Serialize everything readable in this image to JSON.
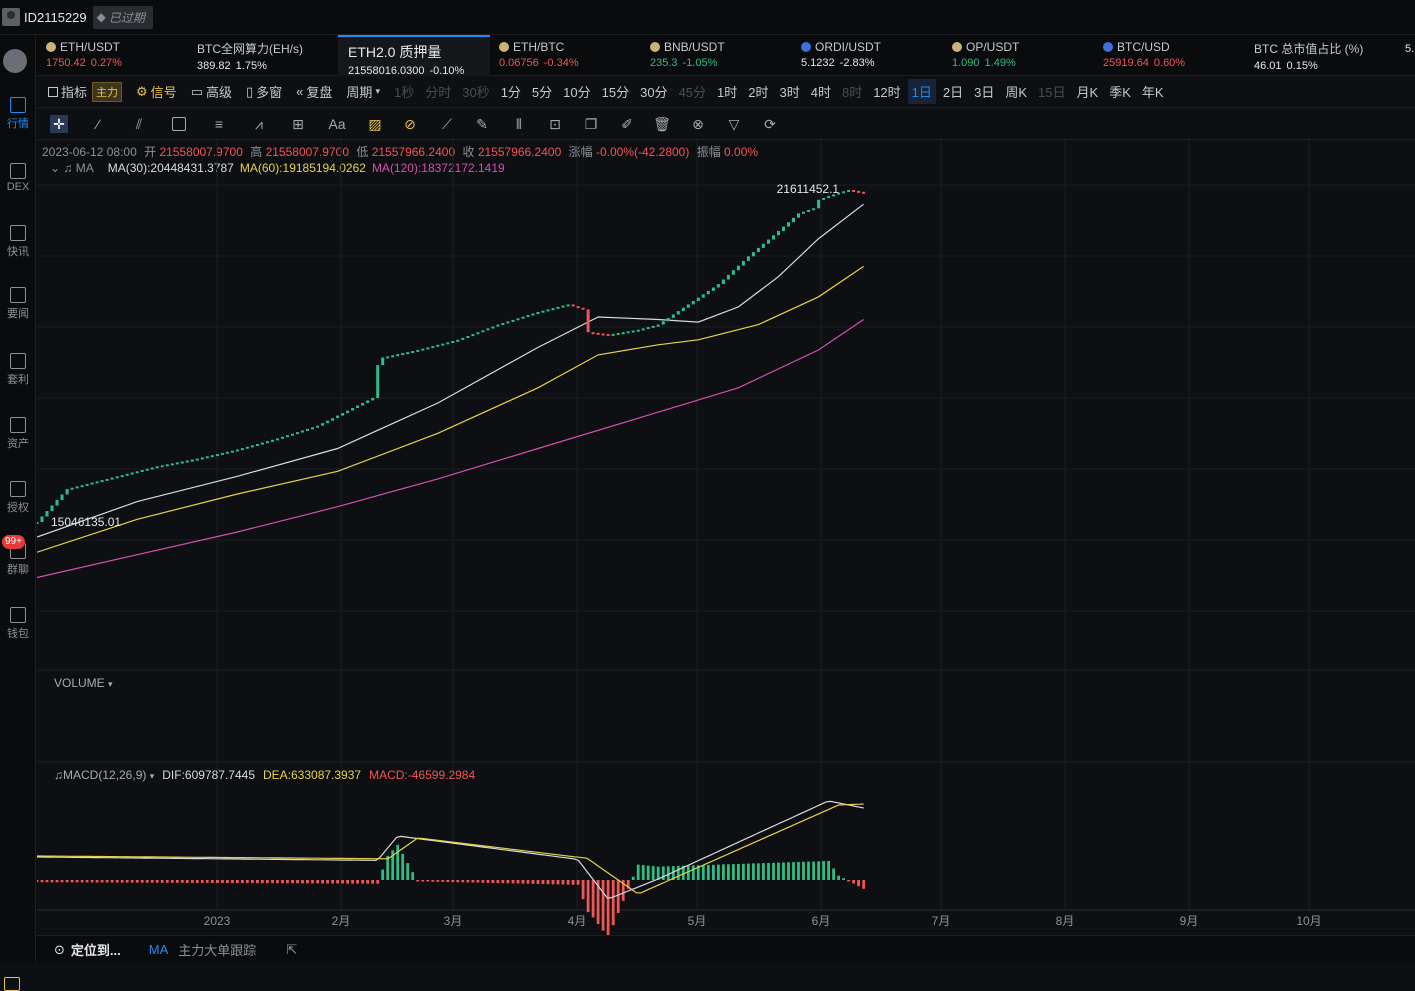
{
  "user": {
    "id": "ID2115229",
    "status": "已过期"
  },
  "sidebar": [
    {
      "label": "行情",
      "icon": "market-icon",
      "active": true
    },
    {
      "label": "DEX",
      "icon": "dex-icon"
    },
    {
      "label": "快讯",
      "icon": "flash-news-icon"
    },
    {
      "label": "要闻",
      "icon": "news-icon"
    },
    {
      "label": "套利",
      "icon": "arbitrage-icon"
    },
    {
      "label": "资产",
      "icon": "assets-icon"
    },
    {
      "label": "授权",
      "icon": "authorization-icon"
    },
    {
      "label": "群聊",
      "icon": "group-chat-icon",
      "badge": "99+"
    },
    {
      "label": "钱包",
      "icon": "wallet-icon"
    }
  ],
  "tickers": [
    {
      "name": "ETH/USDT",
      "price": "1750.42",
      "change": "0.27%",
      "dir": "dn",
      "dot": "gold"
    },
    {
      "name": "BTC全网算力(EH/s)",
      "price": "389.82",
      "change": "1.75%",
      "dir": "wt",
      "dot": ""
    },
    {
      "name": "ETH2.0 质押量",
      "price": "21558016.0300",
      "change": "-0.10%",
      "dir": "wt",
      "dot": "",
      "active": true
    },
    {
      "name": "ETH/BTC",
      "price": "0.06756",
      "change": "-0.34%",
      "dir": "dn",
      "dot": "gold"
    },
    {
      "name": "BNB/USDT",
      "price": "235.3",
      "change": "-1.05%",
      "dir": "up",
      "dot": "gold"
    },
    {
      "name": "ORDI/USDT",
      "price": "5.1232",
      "change": "-2.83%",
      "dir": "wt",
      "dot": "blue"
    },
    {
      "name": "OP/USDT",
      "price": "1.090",
      "change": "1.49%",
      "dir": "up",
      "dot": "gold"
    },
    {
      "name": "BTC/USD",
      "price": "25919.64",
      "change": "0.60%",
      "dir": "dn",
      "dot": "blue"
    },
    {
      "name": "BTC 总市值占比 (%)",
      "price": "46.01",
      "change": "0.15%",
      "dir": "wt",
      "dot": ""
    },
    {
      "name": "",
      "price": "5.",
      "change": "",
      "dir": "wt",
      "dot": ""
    }
  ],
  "periodbar": {
    "indicator": "指标",
    "main_tag": "主力",
    "signal": "信号",
    "advanced": "高级",
    "multi_window": "多窗",
    "replay": "复盘",
    "period": "周期",
    "periods": [
      {
        "label": "1秒",
        "dis": true
      },
      {
        "label": "分时",
        "dis": true
      },
      {
        "label": "30秒",
        "dis": true
      },
      {
        "label": "1分"
      },
      {
        "label": "5分"
      },
      {
        "label": "10分"
      },
      {
        "label": "15分"
      },
      {
        "label": "30分"
      },
      {
        "label": "45分",
        "dis": true
      },
      {
        "label": "1时"
      },
      {
        "label": "2时"
      },
      {
        "label": "3时"
      },
      {
        "label": "4时"
      },
      {
        "label": "8时",
        "dis": true
      },
      {
        "label": "12时"
      },
      {
        "label": "1日",
        "sel": true
      },
      {
        "label": "2日"
      },
      {
        "label": "3日"
      },
      {
        "label": "周K"
      },
      {
        "label": "15日",
        "dis": true
      },
      {
        "label": "月K"
      },
      {
        "label": "季K"
      },
      {
        "label": "年K"
      }
    ]
  },
  "ohlc": {
    "date": "2023-06-12 08:00",
    "open_label": "开",
    "open": "21558007.9700",
    "high_label": "高",
    "high": "21558007.9700",
    "low_label": "低",
    "low": "21557966.2400",
    "close_label": "收",
    "close": "21557966.2400",
    "change_label": "涨幅",
    "change": "-0.00%(-42.2800)",
    "amp_label": "振幅",
    "amp": "0.00%"
  },
  "ma": {
    "label": "MA",
    "ma30": "MA(30):20448431.3787",
    "ma60": "MA(60):19185194.0262",
    "ma120": "MA(120):18372172.1419",
    "colors": {
      "ma30": "#d9dbe0",
      "ma60": "#e8d24a",
      "ma120": "#d64fb3"
    }
  },
  "chart_data": {
    "type": "line",
    "series_kind": "candlestick",
    "max_label": "21611452.1",
    "min_label": "15046135.01",
    "x_ticks": [
      "2023",
      "2月",
      "3月",
      "4月",
      "5月",
      "6月",
      "7月",
      "8月",
      "9月",
      "10月"
    ],
    "price_points": [
      {
        "t": 0,
        "v": 15046135
      },
      {
        "t": 0.03,
        "v": 15700000
      },
      {
        "t": 0.07,
        "v": 15900000
      },
      {
        "t": 0.12,
        "v": 16150000
      },
      {
        "t": 0.16,
        "v": 16300000
      },
      {
        "t": 0.2,
        "v": 16480000
      },
      {
        "t": 0.24,
        "v": 16700000
      },
      {
        "t": 0.28,
        "v": 16950000
      },
      {
        "t": 0.31,
        "v": 17250000
      },
      {
        "t": 0.335,
        "v": 17500000
      },
      {
        "t": 0.34,
        "v": 18150000
      },
      {
        "t": 0.345,
        "v": 18300000
      },
      {
        "t": 0.38,
        "v": 18450000
      },
      {
        "t": 0.42,
        "v": 18650000
      },
      {
        "t": 0.46,
        "v": 18950000
      },
      {
        "t": 0.5,
        "v": 19200000
      },
      {
        "t": 0.53,
        "v": 19350000
      },
      {
        "t": 0.545,
        "v": 19250000
      },
      {
        "t": 0.55,
        "v": 18800000
      },
      {
        "t": 0.57,
        "v": 18750000
      },
      {
        "t": 0.6,
        "v": 18850000
      },
      {
        "t": 0.62,
        "v": 18950000
      },
      {
        "t": 0.65,
        "v": 19350000
      },
      {
        "t": 0.68,
        "v": 19750000
      },
      {
        "t": 0.71,
        "v": 20300000
      },
      {
        "t": 0.74,
        "v": 20800000
      },
      {
        "t": 0.76,
        "v": 21150000
      },
      {
        "t": 0.775,
        "v": 21250000
      },
      {
        "t": 0.78,
        "v": 21420000
      },
      {
        "t": 0.8,
        "v": 21560000
      },
      {
        "t": 0.81,
        "v": 21611452
      },
      {
        "t": 0.825,
        "v": 21558000
      }
    ],
    "ma30_points": [
      {
        "t": 0,
        "v": 14750000
      },
      {
        "t": 0.1,
        "v": 15450000
      },
      {
        "t": 0.2,
        "v": 15950000
      },
      {
        "t": 0.3,
        "v": 16500000
      },
      {
        "t": 0.4,
        "v": 17400000
      },
      {
        "t": 0.5,
        "v": 18500000
      },
      {
        "t": 0.56,
        "v": 19100000
      },
      {
        "t": 0.62,
        "v": 19050000
      },
      {
        "t": 0.66,
        "v": 19000000
      },
      {
        "t": 0.7,
        "v": 19300000
      },
      {
        "t": 0.74,
        "v": 19900000
      },
      {
        "t": 0.78,
        "v": 20650000
      },
      {
        "t": 0.825,
        "v": 21330000
      }
    ],
    "ma60_points": [
      {
        "t": 0,
        "v": 14450000
      },
      {
        "t": 0.1,
        "v": 15100000
      },
      {
        "t": 0.2,
        "v": 15600000
      },
      {
        "t": 0.3,
        "v": 16050000
      },
      {
        "t": 0.4,
        "v": 16800000
      },
      {
        "t": 0.5,
        "v": 17700000
      },
      {
        "t": 0.56,
        "v": 18350000
      },
      {
        "t": 0.62,
        "v": 18550000
      },
      {
        "t": 0.66,
        "v": 18650000
      },
      {
        "t": 0.72,
        "v": 18950000
      },
      {
        "t": 0.78,
        "v": 19500000
      },
      {
        "t": 0.825,
        "v": 20100000
      }
    ],
    "ma120_points": [
      {
        "t": 0,
        "v": 13950000
      },
      {
        "t": 0.1,
        "v": 14400000
      },
      {
        "t": 0.2,
        "v": 14850000
      },
      {
        "t": 0.3,
        "v": 15350000
      },
      {
        "t": 0.4,
        "v": 15900000
      },
      {
        "t": 0.5,
        "v": 16500000
      },
      {
        "t": 0.6,
        "v": 17100000
      },
      {
        "t": 0.7,
        "v": 17700000
      },
      {
        "t": 0.78,
        "v": 18450000
      },
      {
        "t": 0.825,
        "v": 19050000
      }
    ]
  },
  "volume": {
    "label": "VOLUME"
  },
  "macd": {
    "label": "MACD(12,26,9)",
    "dif": "DIF:609787.7445",
    "dea": "DEA:633087.3937",
    "macd": "MACD:-46599.2984"
  },
  "bottombar": {
    "locate": "定位到...",
    "ma": "MA",
    "follow": "主力大单跟踪"
  }
}
